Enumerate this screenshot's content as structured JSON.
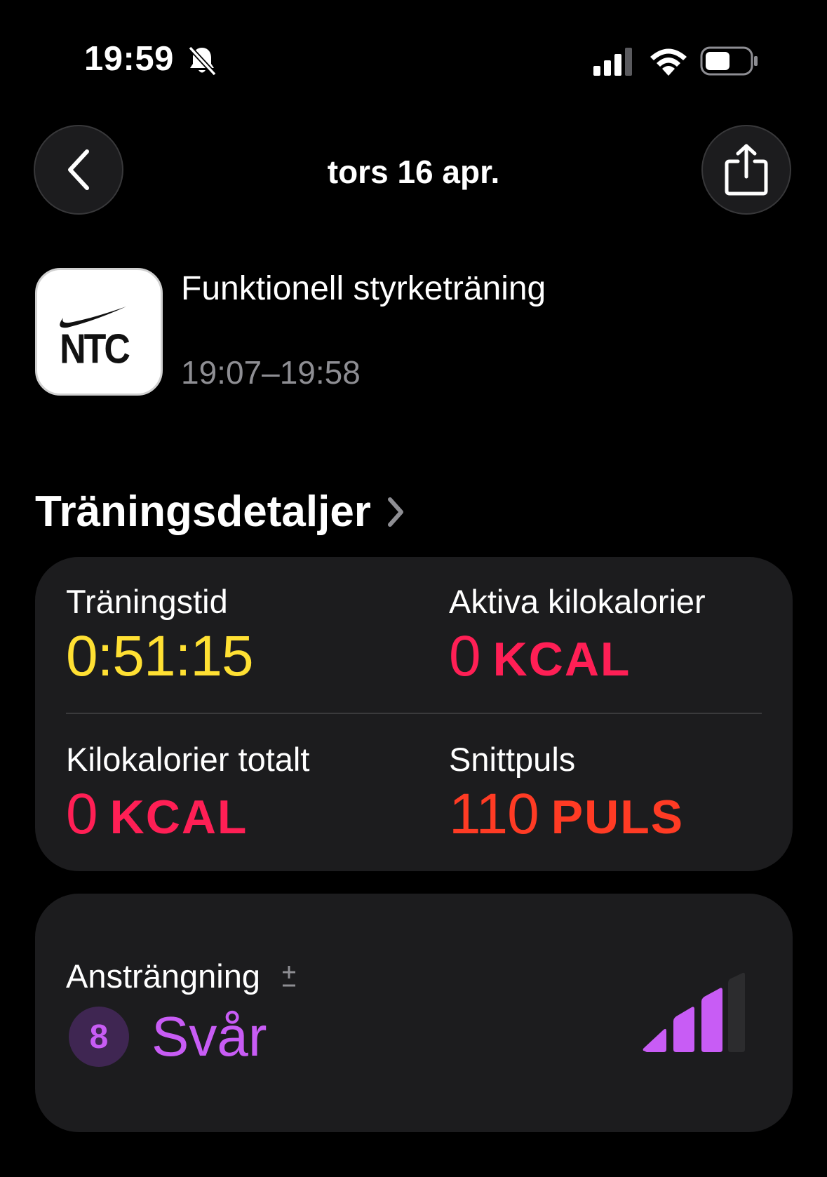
{
  "status_bar": {
    "time": "19:59",
    "icons": [
      "bell-slash-icon",
      "signal-icon",
      "wifi-icon",
      "battery-icon"
    ]
  },
  "nav": {
    "title": "tors 16 apr.",
    "back_icon": "chevron-left-icon",
    "share_icon": "share-icon"
  },
  "workout": {
    "app_logo_text": "NTC",
    "name": "Funktionell styrketräning",
    "time_range": "19:07–19:58"
  },
  "details": {
    "section_title": "Träningsdetaljer",
    "metrics": [
      {
        "label": "Träningstid",
        "value": "0:51:15",
        "unit": "",
        "color": "#ffe033"
      },
      {
        "label": "Aktiva kilokalorier",
        "value": "0",
        "unit": "KCAL",
        "color": "#ff1f55"
      },
      {
        "label": "Kilokalorier totalt",
        "value": "0",
        "unit": "KCAL",
        "color": "#ff1f55"
      },
      {
        "label": "Snittpuls",
        "value": "110",
        "unit": "PULS",
        "color": "#ff3b24"
      }
    ]
  },
  "effort": {
    "label": "Ansträngning",
    "adjust_icon": "plus-minus-icon",
    "score": "8",
    "level_text": "Svår",
    "bars_filled": 3,
    "bars_total": 4,
    "color": "#c85cf5"
  }
}
